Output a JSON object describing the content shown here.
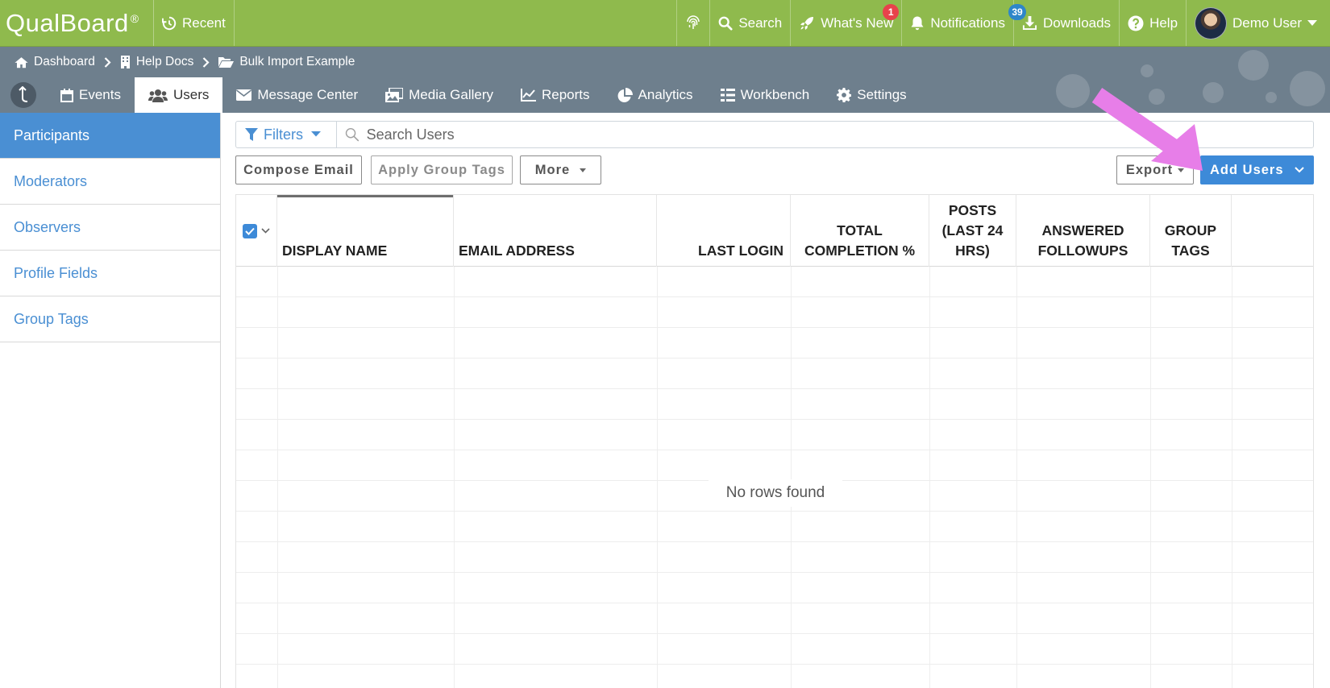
{
  "topbar": {
    "logo": "QualBoard",
    "logo_mark": "®",
    "recent": "Recent",
    "search": "Search",
    "whats_new": "What's New",
    "whats_new_badge": "1",
    "notifications": "Notifications",
    "notifications_badge": "39",
    "downloads": "Downloads",
    "help": "Help",
    "user": "Demo User"
  },
  "breadcrumb": {
    "items": [
      "Dashboard",
      "Help Docs",
      "Bulk Import Example"
    ]
  },
  "nav": {
    "tabs": [
      "Events",
      "Users",
      "Message Center",
      "Media Gallery",
      "Reports",
      "Analytics",
      "Workbench",
      "Settings"
    ],
    "active": "Users"
  },
  "sidebar": {
    "items": [
      "Participants",
      "Moderators",
      "Observers",
      "Profile Fields",
      "Group Tags"
    ],
    "active": "Participants"
  },
  "toolbar": {
    "filters": "Filters",
    "search_placeholder": "Search Users",
    "compose_email": "Compose Email",
    "apply_group_tags": "Apply Group Tags",
    "more": "More",
    "export": "Export",
    "add_users": "Add Users"
  },
  "table": {
    "headers": [
      [
        "DISPLAY NAME"
      ],
      [
        "EMAIL ADDRESS"
      ],
      [
        "LAST LOGIN"
      ],
      [
        "TOTAL",
        "COMPLETION %"
      ],
      [
        "POSTS",
        "(LAST 24",
        "HRS)"
      ],
      [
        "ANSWERED",
        "FOLLOWUPS"
      ],
      [
        "GROUP",
        "TAGS"
      ]
    ],
    "empty_text": "No rows found"
  },
  "colors": {
    "topbar": "#8fba4d",
    "subheader": "#6e7f8d",
    "accent": "#4a8fd3",
    "primary_button": "#3d8ad8",
    "annotation_arrow": "#e77ee8"
  }
}
